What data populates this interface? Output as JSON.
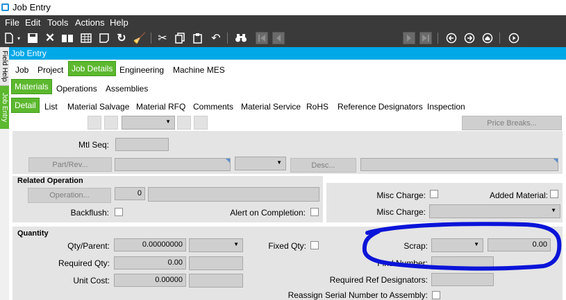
{
  "window": {
    "title": "Job Entry"
  },
  "menu": [
    "File",
    "Edit",
    "Tools",
    "Actions",
    "Help"
  ],
  "side_tabs": [
    "Field Help",
    "Job Entry"
  ],
  "header": {
    "title": "Job Entry"
  },
  "tabs_l1": [
    "Job",
    "Project",
    "Job Details",
    "Engineering",
    "Machine MES"
  ],
  "tabs_l2": [
    "Materials",
    "Operations",
    "Assemblies"
  ],
  "tabs_l3": [
    "Detail",
    "List",
    "Material Salvage",
    "Material RFQ",
    "Comments",
    "Material Service",
    "RoHS",
    "Reference Designators",
    "Inspection"
  ],
  "detail": {
    "price_breaks_label": "Price Breaks...",
    "mtl_seq_label": "Mtl Seq:",
    "part_rev_label": "Part/Rev...",
    "desc_label": "Desc..."
  },
  "related_operation": {
    "title": "Related Operation",
    "operation_label": "Operation...",
    "operation_value": "0",
    "backflush_label": "Backflush:",
    "alert_label": "Alert on Completion:"
  },
  "misc": {
    "misc_charge_chk_label": "Misc Charge:",
    "added_material_label": "Added Material:",
    "misc_charge_combo_label": "Misc Charge:"
  },
  "quantity": {
    "title": "Quantity",
    "qty_parent_label": "Qty/Parent:",
    "qty_parent_value": "0.00000000",
    "fixed_qty_label": "Fixed Qty:",
    "scrap_label": "Scrap:",
    "scrap_value": "0.00",
    "required_qty_label": "Required Qty:",
    "required_qty_value": "0.00",
    "find_number_label": "Find Number:",
    "unit_cost_label": "Unit Cost:",
    "unit_cost_value": "0.00000",
    "req_ref_label": "Required Ref Designators:",
    "reassign_label": "Reassign Serial Number to Assembly:"
  },
  "annotation": {
    "color": "#0a14d8"
  }
}
